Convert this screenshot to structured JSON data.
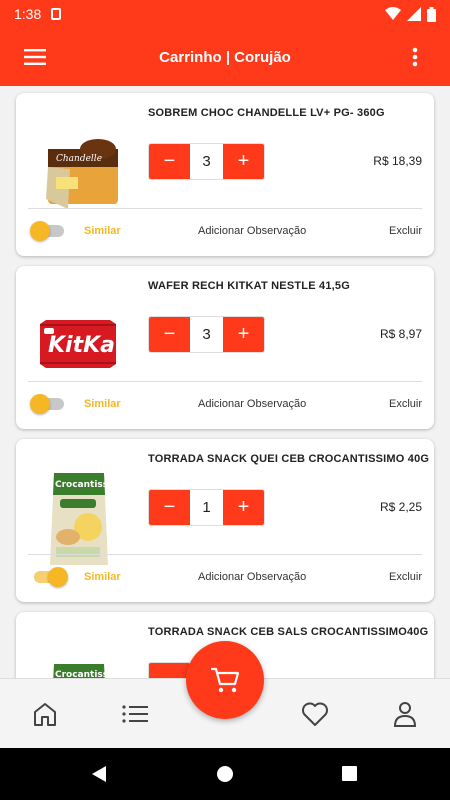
{
  "status_bar": {
    "time": "1:38"
  },
  "header": {
    "title": "Carrinho | Corujão"
  },
  "cart": {
    "items": [
      {
        "name": "SOBREM CHOC CHANDELLE LV+ PG- 360G",
        "quantity": "3",
        "price": "R$ 18,39",
        "similar_enabled": false,
        "similar_label": "Similar",
        "observation_label": "Adicionar Observação",
        "delete_label": "Excluir",
        "image": "chocolate-dessert-pack"
      },
      {
        "name": "WAFER RECH KITKAT NESTLE 41,5G",
        "quantity": "3",
        "price": "R$ 8,97",
        "similar_enabled": false,
        "similar_label": "Similar",
        "observation_label": "Adicionar Observação",
        "delete_label": "Excluir",
        "image": "kitkat-wrapper"
      },
      {
        "name": "TORRADA SNACK QUEI CEB CROCANTISSIMO 40G",
        "quantity": "1",
        "price": "R$ 2,25",
        "similar_enabled": true,
        "similar_label": "Similar",
        "observation_label": "Adicionar Observação",
        "delete_label": "Excluir",
        "image": "crocantissimo-original-bag"
      },
      {
        "name": "TORRADA SNACK CEB SALS CROCANTISSIMO40G",
        "quantity": "",
        "price": "",
        "similar_enabled": false,
        "similar_label": "",
        "observation_label": "",
        "delete_label": "",
        "image": "crocantissimo-integral-bag"
      }
    ],
    "minus_symbol": "−",
    "plus_symbol": "+"
  },
  "bottom_nav": {
    "items": [
      "home-icon",
      "list-icon",
      "cart-icon",
      "heart-icon",
      "person-icon"
    ]
  },
  "colors": {
    "brand": "#ff3a1a",
    "toggle": "#f5b824"
  }
}
